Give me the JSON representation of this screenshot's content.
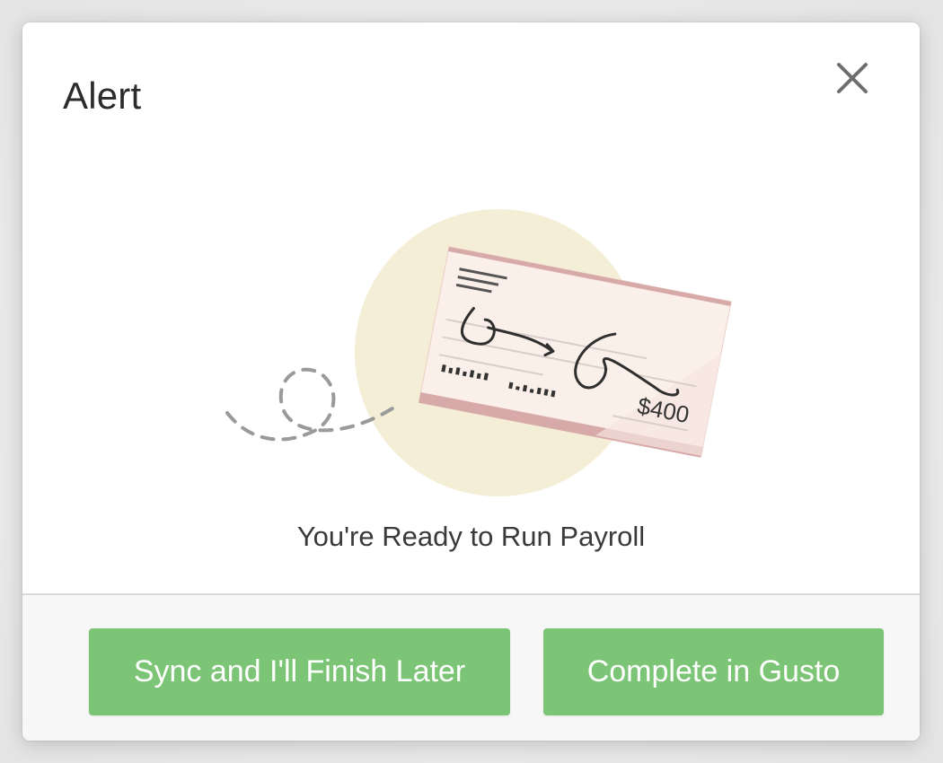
{
  "dialog": {
    "title": "Alert",
    "close_icon": "close-icon",
    "message": "You're Ready to Run Payroll"
  },
  "illustration": {
    "check_amount": "$400",
    "icon": "paycheck-illustration"
  },
  "actions": {
    "secondary_label": "Sync and I'll Finish Later",
    "primary_label": "Complete in Gusto"
  },
  "colors": {
    "button_green": "#7dc576",
    "circle": "#f4eed6",
    "check_paper": "#fbefe9",
    "check_border": "#d7a9a9"
  }
}
